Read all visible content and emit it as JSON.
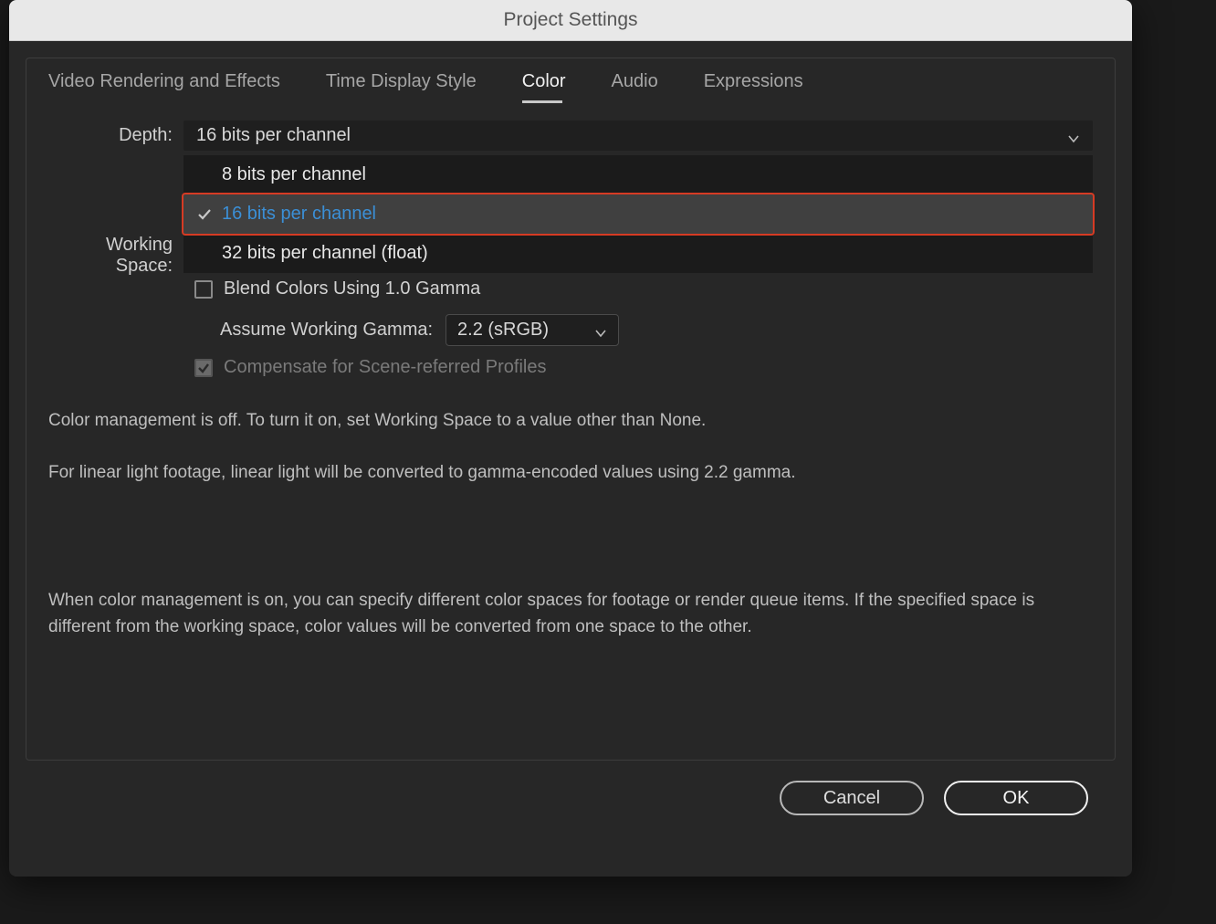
{
  "dialog": {
    "title": "Project Settings"
  },
  "tabs": [
    {
      "label": "Video Rendering and Effects",
      "active": false
    },
    {
      "label": "Time Display Style",
      "active": false
    },
    {
      "label": "Color",
      "active": true
    },
    {
      "label": "Audio",
      "active": false
    },
    {
      "label": "Expressions",
      "active": false
    }
  ],
  "form": {
    "depth_label": "Depth:",
    "depth_value": "16 bits per channel",
    "depth_options": [
      {
        "label": "8 bits per channel",
        "selected": false
      },
      {
        "label": "16 bits per channel",
        "selected": true,
        "highlighted": true
      },
      {
        "label": "32 bits per channel (float)",
        "selected": false
      }
    ],
    "working_space_label": "Working Space:",
    "blend_checkbox_label": "Blend Colors Using 1.0 Gamma",
    "blend_checked": false,
    "assume_gamma_label": "Assume Working Gamma:",
    "assume_gamma_value": "2.2 (sRGB)",
    "compensate_label": "Compensate for Scene-referred Profiles",
    "compensate_checked": true
  },
  "info": {
    "line1": "Color management is off. To turn it on, set Working Space to a value other than None.",
    "line2": "For linear light footage, linear light will be converted to gamma-encoded values using 2.2 gamma.",
    "line3": "When color management is on, you can specify different color spaces for footage or render queue items. If the specified space is different from the working space, color values will be converted from one space to the other."
  },
  "buttons": {
    "cancel": "Cancel",
    "ok": "OK"
  }
}
